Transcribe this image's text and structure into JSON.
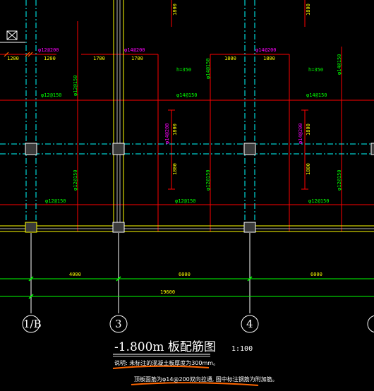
{
  "dimensions_top": {
    "dim_a": "1200",
    "dim_b": "1200",
    "dim_c": "1700",
    "dim_d": "1700",
    "dim_e": "1800",
    "dim_f": "1800"
  },
  "dimensions_vertical": {
    "v_top_1": "1800",
    "v_top_2": "1800",
    "v_mid_1": "1800",
    "v_mid_2": "1800",
    "v_bot_1": "1800",
    "v_bot_2": "1800"
  },
  "thickness_labels": {
    "h1": "h=350",
    "h2": "h=350"
  },
  "rebar_top_magenta": {
    "r1": "φ12@200",
    "r2": "φ14@200",
    "r3": "φ14@200"
  },
  "rebar_vertical_magenta": {
    "m1": "φ14@200",
    "m2": "φ14@200"
  },
  "rebar_green_labels": {
    "g_row1_a": "φ12@150",
    "g_row1_b": "φ14@150",
    "g_row1_c": "φ14@150",
    "g_row2_a": "φ12@150",
    "g_row2_b": "φ12@150",
    "g_row2_c": "φ12@150",
    "gv_top_1": "φ12@150",
    "gv_top_2": "φ14@150",
    "gv_top_3": "φ14@150",
    "gv_bot_1": "φ12@150",
    "gv_bot_2": "φ12@150",
    "gv_bot_3": "φ12@150"
  },
  "bottom_dimensions": {
    "span_1": "4000",
    "span_2": "6000",
    "span_3": "6000",
    "total": "19600"
  },
  "axis_labels": {
    "axis_1": "1/B",
    "axis_2": "3",
    "axis_3": "4"
  },
  "title_block": {
    "title": "-1.800m 板配筋图",
    "scale": "1:100",
    "note_1": "说明: 未标注的混凝土板厚度为300mm。",
    "note_2": "顶板面筋为φ14@200双向拉通, 图中标注钢筋为附加筋。"
  },
  "colors": {
    "background": "#000000",
    "wall": "#ffff00",
    "axis_line": "#ffffff",
    "centerline": "#00ffff",
    "rebar_red": "#ff0000",
    "text_green": "#00ff00",
    "text_magenta": "#ff00ff",
    "underline": "#ff6600"
  }
}
